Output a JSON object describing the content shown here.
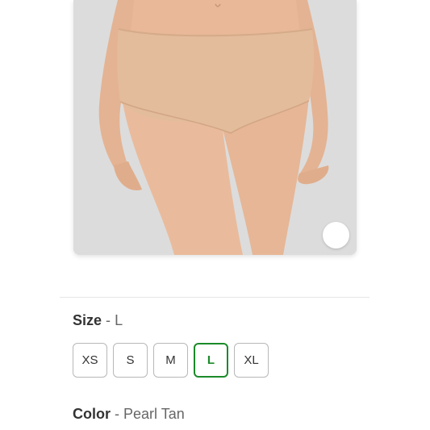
{
  "product_image": {
    "alt": "",
    "background_color": "#dcdcdc"
  },
  "size": {
    "label": "Size",
    "separator": "-",
    "selected_value": "L",
    "options": [
      {
        "label": "XS",
        "selected": false
      },
      {
        "label": "S",
        "selected": false
      },
      {
        "label": "M",
        "selected": false
      },
      {
        "label": "L",
        "selected": true
      },
      {
        "label": "XL",
        "selected": false
      }
    ]
  },
  "color": {
    "label": "Color",
    "separator": "-",
    "selected_value": "Pearl Tan"
  },
  "theme": {
    "selected_accent": "#1b8a2a",
    "text_primary": "#333333",
    "text_secondary": "#666666"
  }
}
